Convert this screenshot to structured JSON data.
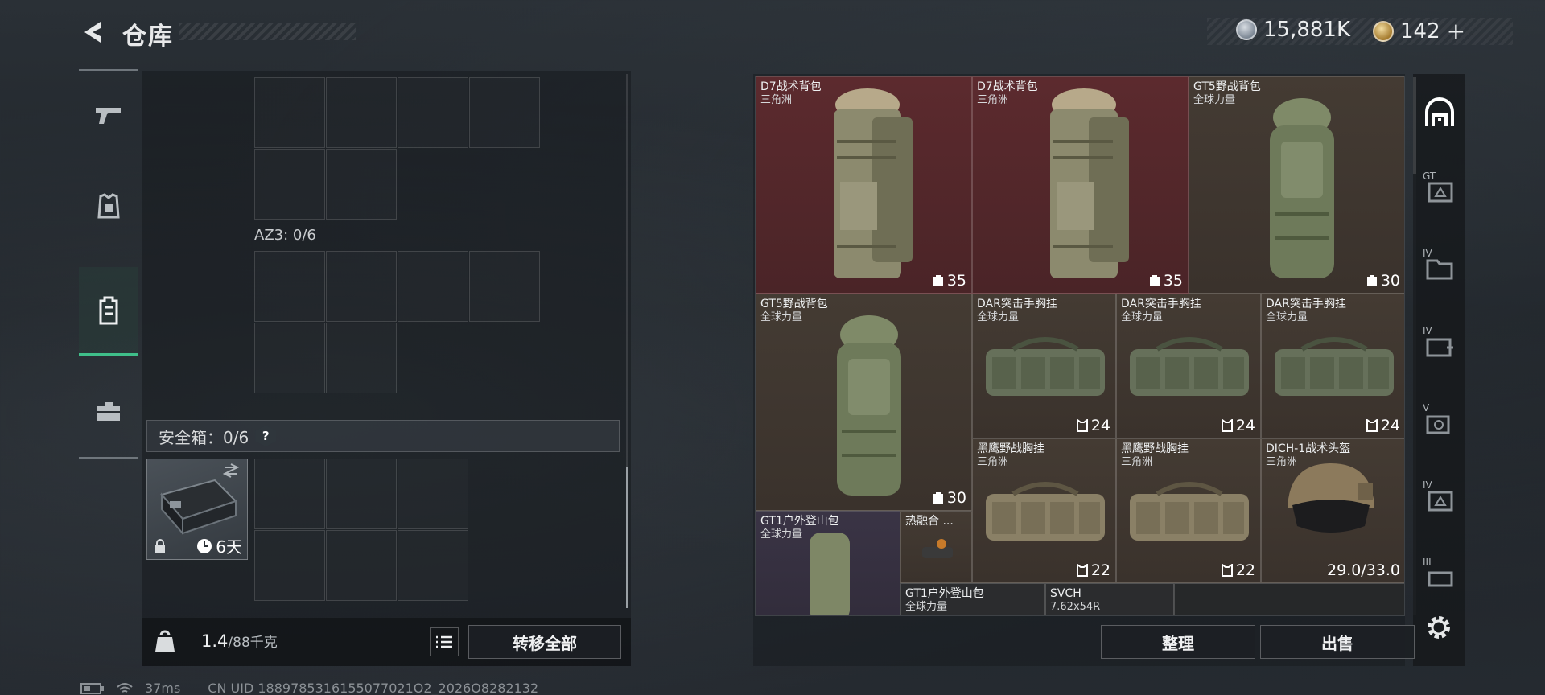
{
  "header": {
    "title": "仓库",
    "currency_silver": "15,881K",
    "currency_gold": "142",
    "gold_plus": "+"
  },
  "left": {
    "container_label": "AZ3: 0/6",
    "safe_label": "安全箱：0/6",
    "safe_help": "?",
    "safe_timer": "6天",
    "weight_value": "1.4",
    "weight_unit": "/88千克",
    "transfer_all": "转移全部"
  },
  "items": [
    {
      "name": "D7战术背包",
      "sub": "三角洲",
      "cap": "35",
      "bg": "red"
    },
    {
      "name": "D7战术背包",
      "sub": "三角洲",
      "cap": "35",
      "bg": "red"
    },
    {
      "name": "GT5野战背包",
      "sub": "全球力量",
      "cap": "30",
      "bg": "brown"
    },
    {
      "name": "GT5野战背包",
      "sub": "全球力量",
      "cap": "30",
      "bg": "brown"
    },
    {
      "name": "DAR突击手胸挂",
      "sub": "全球力量",
      "cap": "24",
      "bg": "brown"
    },
    {
      "name": "DAR突击手胸挂",
      "sub": "全球力量",
      "cap": "24",
      "bg": "brown"
    },
    {
      "name": "DAR突击手胸挂",
      "sub": "全球力量",
      "cap": "24",
      "bg": "brown"
    },
    {
      "name": "黑鹰野战胸挂",
      "sub": "三角洲",
      "cap": "22",
      "bg": "brown"
    },
    {
      "name": "黑鹰野战胸挂",
      "sub": "三角洲",
      "cap": "22",
      "bg": "brown"
    },
    {
      "name": "DICH-1战术头盔",
      "sub": "三角洲",
      "cap": "29.0/33.0",
      "bg": "brown"
    },
    {
      "name": "GT1户外登山包",
      "sub": "全球力量",
      "cap": "",
      "bg": "purple"
    },
    {
      "name": "热融合 ...",
      "sub": "",
      "cap": "",
      "bg": "brown"
    },
    {
      "name": "GT1户外登山包",
      "sub": "全球力量",
      "cap": "",
      "bg": "dark"
    },
    {
      "name": "SVCH",
      "sub": "7.62x54R",
      "cap": "",
      "bg": "dark"
    }
  ],
  "right_tab_levels": [
    "",
    "GT",
    "IV",
    "IV",
    "V",
    "IV",
    "III"
  ],
  "buttons": {
    "sort": "整理",
    "sell": "出售"
  },
  "status": {
    "ping": "37ms",
    "uid": "CN UID 1889785316155077021O2_2026O8282132"
  },
  "colors": {
    "accent_green": "#3fbf8a",
    "item_red": "#5c2a2e",
    "item_brown": "#443b33",
    "item_purple": "#3a3445"
  },
  "icons": {
    "back": "back-arrow-icon",
    "weapon": "pistol-icon",
    "armor": "armor-icon",
    "backpack": "backpack-icon",
    "medkit": "toolbox-icon",
    "lock": "lock-icon",
    "clock": "clock-icon",
    "list": "list-icon",
    "settings": "gear-icon",
    "backpack_cap": "backpack-capacity-icon",
    "vest_cap": "vest-capacity-icon"
  }
}
